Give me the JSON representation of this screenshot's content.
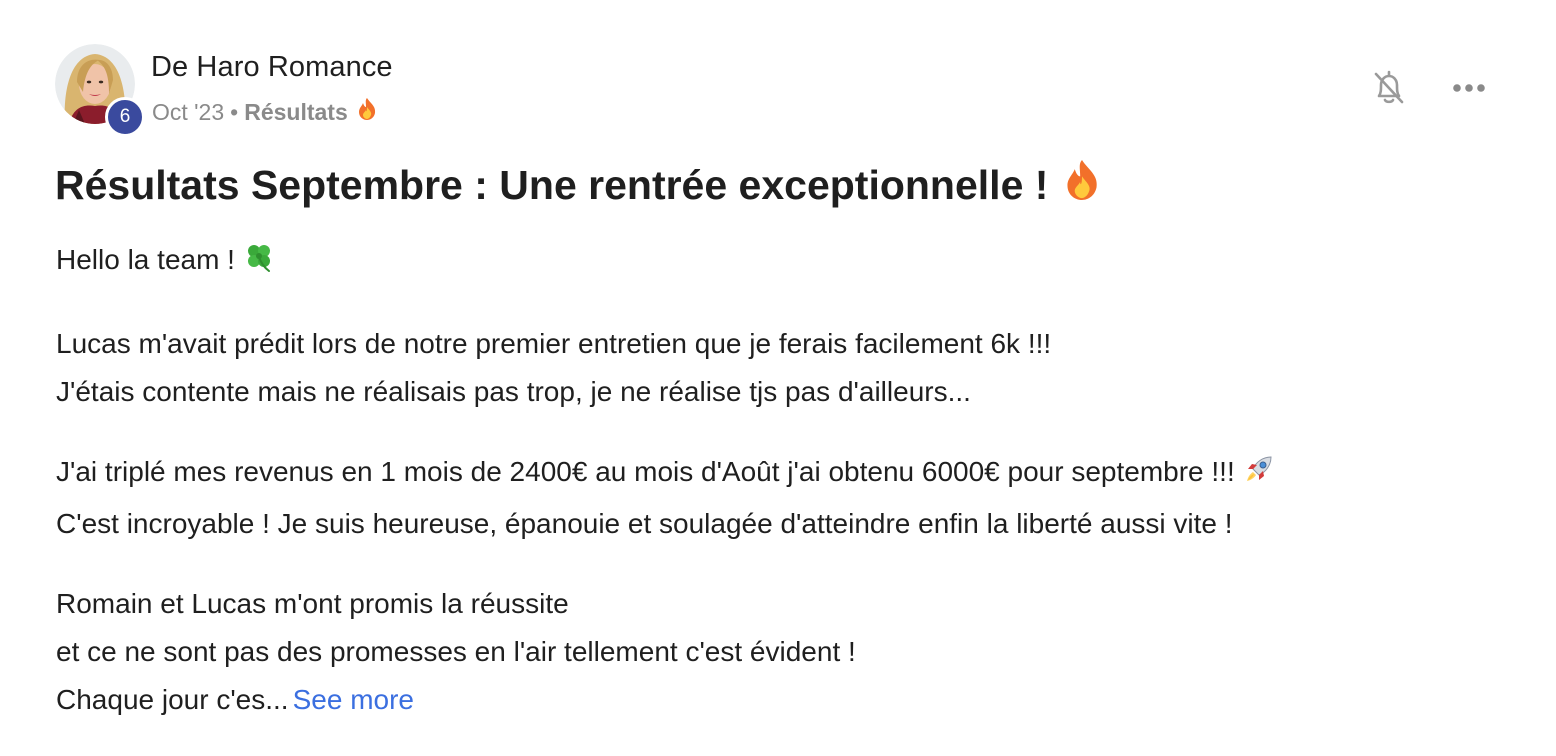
{
  "author": {
    "name": "De Haro Romance",
    "level": "6"
  },
  "meta": {
    "date": "Oct '23",
    "separator": "•",
    "category": "Résultats"
  },
  "title": "Résultats Septembre : Une rentrée exceptionnelle !",
  "body": {
    "greeting": "Hello la team !",
    "para1_line1": "Lucas m'avait prédit lors de notre premier entretien que je ferais facilement 6k !!!",
    "para1_line2": "J'étais contente mais ne réalisais pas trop, je ne réalise tjs pas d'ailleurs...",
    "para2_line1": "J'ai triplé mes revenus en 1 mois de 2400€ au mois d'Août j'ai obtenu 6000€ pour septembre !!!",
    "para2_line2": "C'est incroyable ! Je suis heureuse, épanouie et soulagée d'atteindre enfin la liberté aussi vite !",
    "para3_line1": "Romain et Lucas m'ont promis la réussite",
    "para3_line2": "et ce ne sont pas des promesses en l'air tellement c'est évident !",
    "para3_line3": "Chaque jour c'es...",
    "see_more": "See more"
  },
  "icons": {
    "notification": "bell-off-icon",
    "more": "more-horizontal-icon",
    "category_emoji": "fire-icon",
    "title_emoji": "fire-icon",
    "greeting_emoji": "four-leaf-clover-icon",
    "para2_emoji": "rocket-icon"
  },
  "colors": {
    "link": "#3b6fe0",
    "level_badge": "#3a4a9e",
    "muted_text": "#8a8a8a",
    "text": "#1f1f1f"
  }
}
